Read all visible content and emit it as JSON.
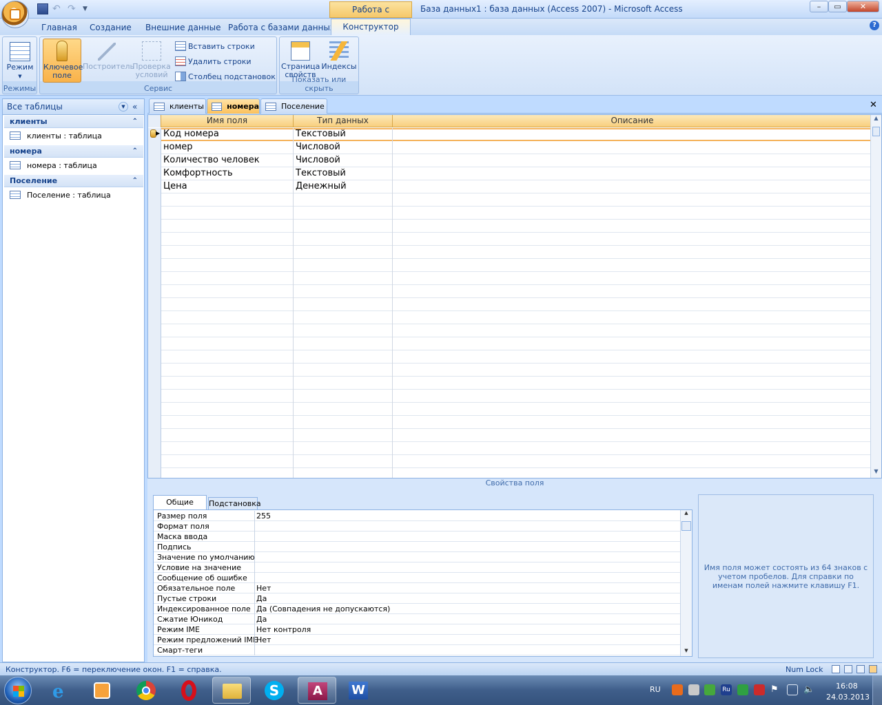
{
  "window": {
    "title": "База данных1 : база данных (Access 2007) - Microsoft Access",
    "context_tab_group": "Работа с таблицами",
    "controls": {
      "minimize": "–",
      "maximize": "▭",
      "close": "✕"
    }
  },
  "ribbon_tabs": [
    "Главная",
    "Создание",
    "Внешние данные",
    "Работа с базами данных",
    "Конструктор"
  ],
  "active_ribbon_tab": "Конструктор",
  "ribbon": {
    "modes_group": {
      "label": "Режимы",
      "mode_button": "Режим"
    },
    "service_group": {
      "label": "Сервис",
      "key_field_line1": "Ключевое",
      "key_field_line2": "поле",
      "builder": "Построитель",
      "test_rules_line1": "Проверка",
      "test_rules_line2": "условий",
      "insert_rows": "Вставить строки",
      "delete_rows": "Удалить строки",
      "lookup_column": "Столбец  подстановок"
    },
    "show_hide_group": {
      "label": "Показать или скрыть",
      "property_sheet_line1": "Страница",
      "property_sheet_line2": "свойств",
      "indexes": "Индексы"
    }
  },
  "nav_pane": {
    "header": "Все таблицы",
    "groups": [
      {
        "title": "клиенты",
        "item": "клиенты : таблица"
      },
      {
        "title": "номера",
        "item": "номера : таблица"
      },
      {
        "title": "Поселение",
        "item": "Поселение : таблица"
      }
    ]
  },
  "doc_tabs": [
    "клиенты",
    "номера",
    "Поселение"
  ],
  "active_doc_tab": "номера",
  "design_grid": {
    "columns": [
      "Имя поля",
      "Тип данных",
      "Описание"
    ],
    "rows": [
      {
        "name": "Код номера",
        "type": "Текстовый",
        "desc": ""
      },
      {
        "name": "номер",
        "type": "Числовой",
        "desc": ""
      },
      {
        "name": "Количество человек",
        "type": "Числовой",
        "desc": ""
      },
      {
        "name": "Комфортность",
        "type": "Текстовый",
        "desc": ""
      },
      {
        "name": "Цена",
        "type": "Денежный",
        "desc": ""
      }
    ]
  },
  "field_properties": {
    "label": "Свойства поля",
    "tabs": [
      "Общие",
      "Подстановка"
    ],
    "rows": [
      {
        "name": "Размер поля",
        "value": "255"
      },
      {
        "name": "Формат поля",
        "value": ""
      },
      {
        "name": "Маска ввода",
        "value": ""
      },
      {
        "name": "Подпись",
        "value": ""
      },
      {
        "name": "Значение по умолчанию",
        "value": ""
      },
      {
        "name": "Условие на значение",
        "value": ""
      },
      {
        "name": "Сообщение об ошибке",
        "value": ""
      },
      {
        "name": "Обязательное поле",
        "value": "Нет"
      },
      {
        "name": "Пустые строки",
        "value": "Да"
      },
      {
        "name": "Индексированное поле",
        "value": "Да (Совпадения не допускаются)"
      },
      {
        "name": "Сжатие Юникод",
        "value": "Да"
      },
      {
        "name": "Режим IME",
        "value": "Нет контроля"
      },
      {
        "name": "Режим предложений IME",
        "value": "Нет"
      },
      {
        "name": "Смарт-теги",
        "value": ""
      }
    ],
    "help_text": "Имя поля может состоять из 64 знаков с учетом пробелов.  Для справки по именам полей нажмите клавишу F1."
  },
  "status_bar": {
    "text": "Конструктор.  F6 = переключение окон.  F1 = справка.",
    "num_lock": "Num Lock"
  },
  "taskbar": {
    "lang": "RU",
    "time": "16:08",
    "date": "24.03.2013",
    "tray_ru": "Ru"
  },
  "colors": {
    "accent": "#f8cf7e",
    "ribbon": "#d3e3f8",
    "title_text": "#15428b"
  }
}
